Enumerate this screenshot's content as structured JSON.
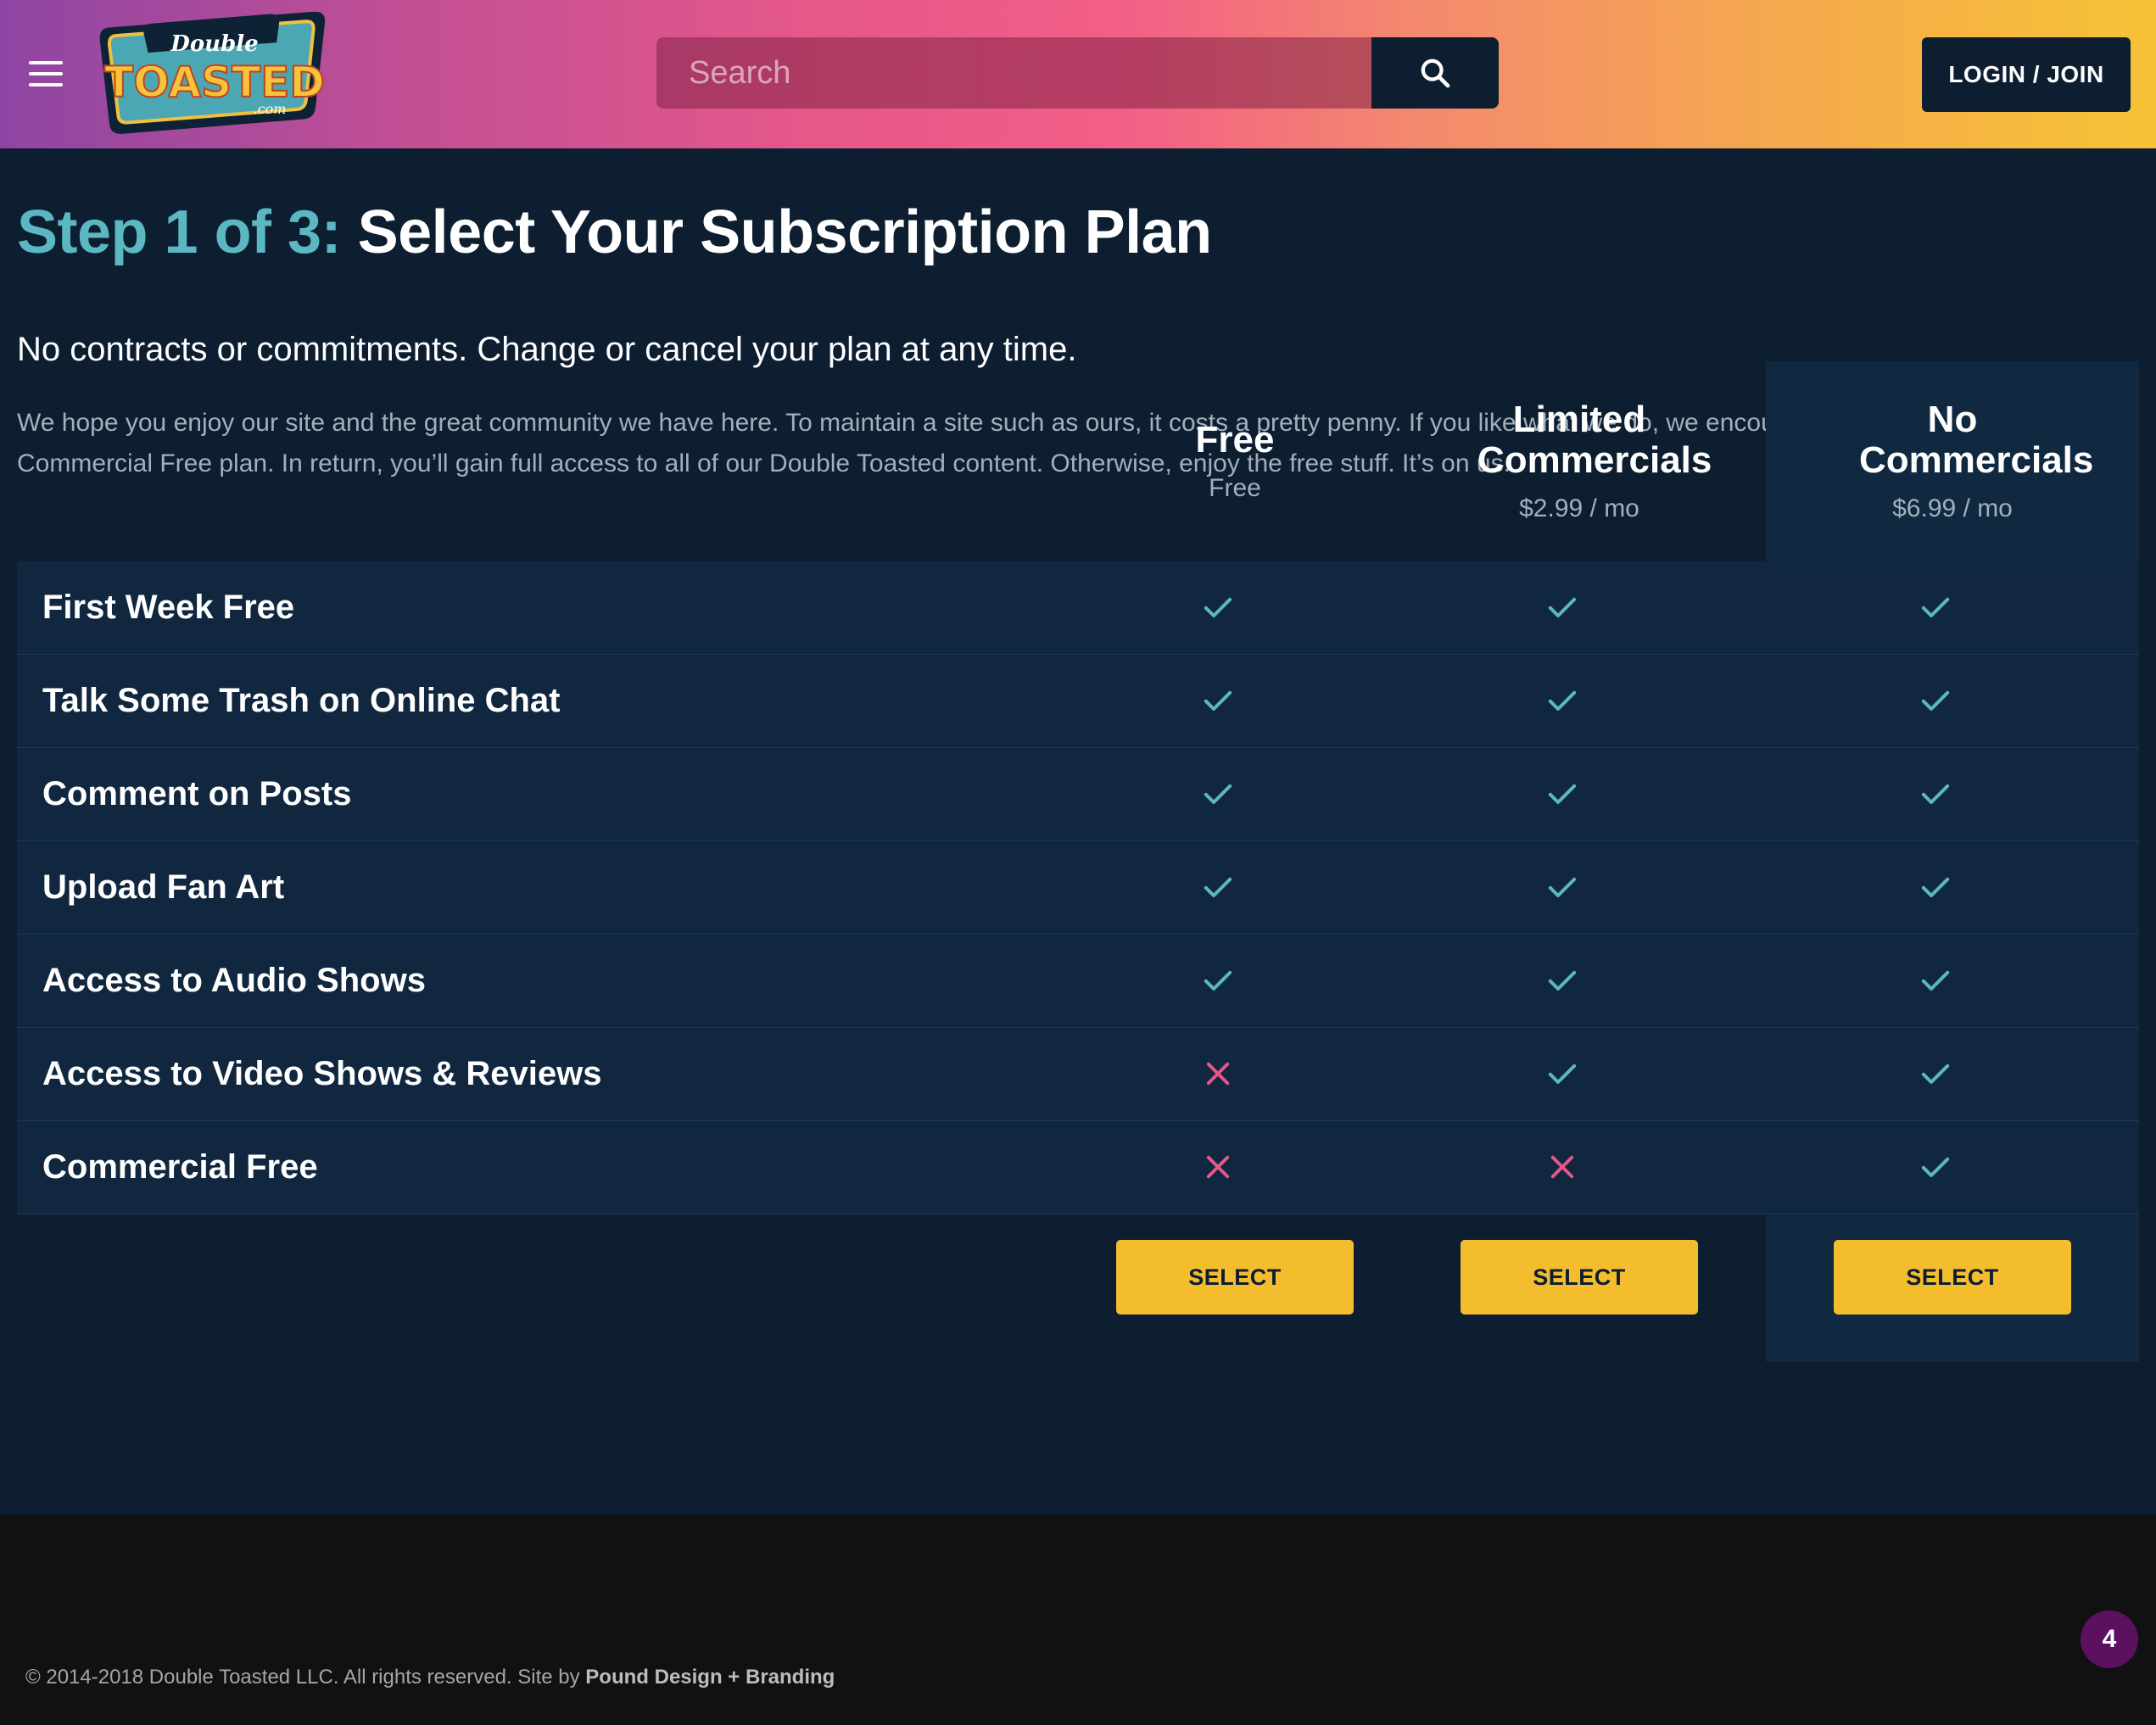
{
  "header": {
    "logo_top": "Double",
    "logo_main": "TOASTED",
    "logo_sub": ".com",
    "search_placeholder": "Search",
    "login_label": "LOGIN / JOIN"
  },
  "main": {
    "step_label": "Step 1 of 3:",
    "title": "Select Your Subscription Plan",
    "subtitle": "No contracts or commitments. Change or cancel your plan at any time.",
    "intro": "We hope you enjoy our site and the great community we have here. To maintain a site such as ours, it costs a pretty penny. If you like what we do, we encourage you sign up for our Commercial Free plan. In return, you’ll gain full access to all of our Double Toasted content. Otherwise, enjoy the free stuff. It’s on us."
  },
  "plans": [
    {
      "name": "Free",
      "price": "Free",
      "select_label": "SELECT"
    },
    {
      "name": "Limited Commercials",
      "price": "$2.99 / mo",
      "select_label": "SELECT"
    },
    {
      "name": "No Commercials",
      "price": "$6.99 / mo",
      "select_label": "SELECT"
    }
  ],
  "features": [
    {
      "label": "First Week Free",
      "included": [
        true,
        true,
        true
      ]
    },
    {
      "label": "Talk Some Trash on Online Chat",
      "included": [
        true,
        true,
        true
      ]
    },
    {
      "label": "Comment on Posts",
      "included": [
        true,
        true,
        true
      ]
    },
    {
      "label": "Upload Fan Art",
      "included": [
        true,
        true,
        true
      ]
    },
    {
      "label": "Access to Audio Shows",
      "included": [
        true,
        true,
        true
      ]
    },
    {
      "label": "Access to Video Shows & Reviews",
      "included": [
        false,
        true,
        true
      ]
    },
    {
      "label": "Commercial Free",
      "included": [
        false,
        false,
        true
      ]
    }
  ],
  "footer": {
    "copyright": "© 2014-2018 Double Toasted LLC. All rights reserved. Site by ",
    "credit": "Pound Design + Branding",
    "badge_count": "4"
  },
  "colors": {
    "background": "#0c1e30",
    "accent_teal": "#5bb8c3",
    "check": "#5bb8c3",
    "cross": "#e6578a",
    "select_button": "#f4bd2e",
    "footer_bg": "#111111",
    "badge": "#5c1160"
  },
  "icons": {
    "menu": "hamburger-icon",
    "search": "search-icon",
    "included": "check-icon",
    "excluded": "cross-icon"
  }
}
